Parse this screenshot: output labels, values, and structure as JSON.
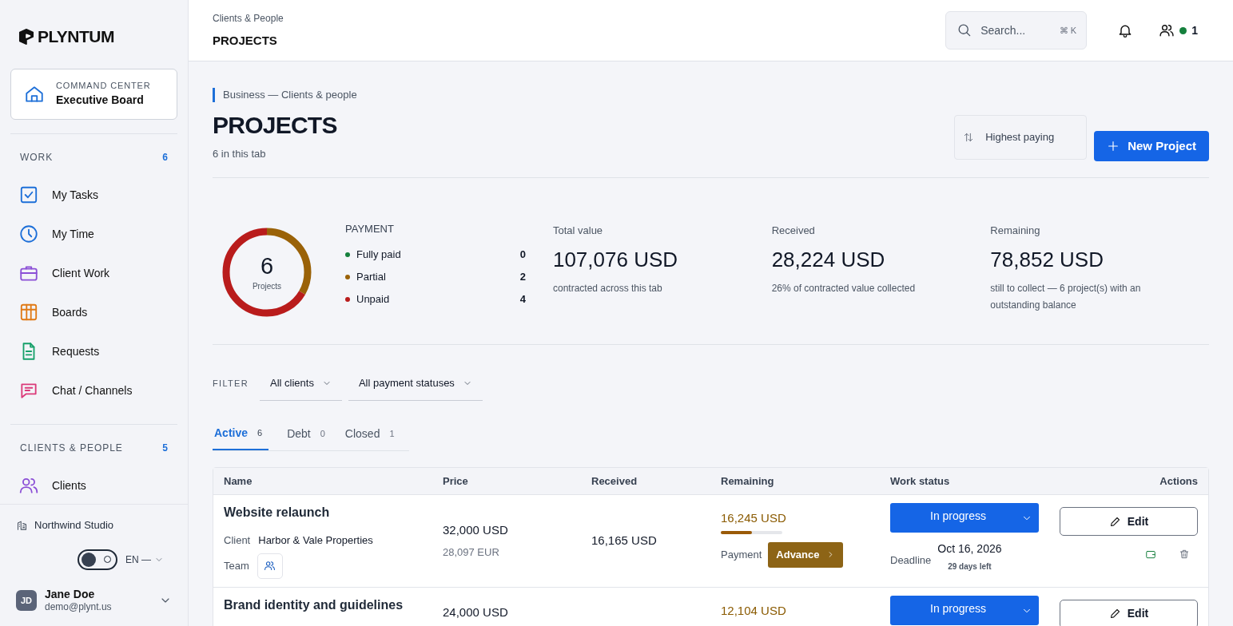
{
  "sidebar": {
    "logo": "PLYNTUM",
    "command_center": {
      "label": "COMMAND CENTER",
      "title": "Executive Board"
    },
    "sections": [
      {
        "title": "WORK",
        "count": "6",
        "items": [
          {
            "label": "My Tasks",
            "kind": "tasks",
            "color": "#1d6fd8"
          },
          {
            "label": "My Time",
            "kind": "time",
            "color": "#1d6fd8"
          },
          {
            "label": "Client Work",
            "kind": "briefcase",
            "color": "#8b4fd6"
          },
          {
            "label": "Boards",
            "kind": "boards",
            "color": "#e07a16"
          },
          {
            "label": "Requests",
            "kind": "document",
            "color": "#16a06a"
          },
          {
            "label": "Chat / Channels",
            "kind": "chat",
            "color": "#db3a7a"
          }
        ]
      },
      {
        "title": "CLIENTS & PEOPLE",
        "count": "5",
        "items": [
          {
            "label": "Clients",
            "kind": "people",
            "color": "#8b4fd6"
          }
        ]
      }
    ],
    "workspace": "Northwind Studio",
    "theme_toggle": {
      "on": false
    },
    "language": "EN —",
    "user": {
      "initials": "JD",
      "name": "Jane Doe",
      "email": "demo@plynt.us"
    }
  },
  "topbar": {
    "breadcrumb": "Clients & People",
    "title": "PROJECTS",
    "search": {
      "placeholder": "Search...",
      "shortcut": "⌘ K"
    },
    "online_count": "1"
  },
  "header": {
    "eyebrow": "Business — Clients & people",
    "title": "PROJECTS",
    "subtitle": "6 in this tab",
    "sort": "Highest paying",
    "new_button": "New Project"
  },
  "summary": {
    "donut": {
      "count": "6",
      "label": "Projects"
    },
    "payment": {
      "title": "PAYMENT",
      "items": [
        {
          "label": "Fully paid",
          "count": "0",
          "color": "#15803d"
        },
        {
          "label": "Partial",
          "count": "2",
          "color": "#9a6208"
        },
        {
          "label": "Unpaid",
          "count": "4",
          "color": "#b91c1c"
        }
      ]
    },
    "stats": [
      {
        "label": "Total value",
        "value": "107,076 USD",
        "note": "contracted across this tab"
      },
      {
        "label": "Received",
        "value": "28,224 USD",
        "note": "26% of contracted value collected"
      },
      {
        "label": "Remaining",
        "value": "78,852 USD",
        "note": "still to collect — 6 project(s) with an outstanding balance"
      }
    ]
  },
  "filter": {
    "label": "FILTER",
    "selects": [
      "All clients",
      "All payment statuses"
    ]
  },
  "tabs": [
    {
      "label": "Active",
      "count": "6",
      "selected": true
    },
    {
      "label": "Debt",
      "count": "0",
      "selected": false
    },
    {
      "label": "Closed",
      "count": "1",
      "selected": false
    }
  ],
  "table": {
    "columns": [
      "Name",
      "Price",
      "Received",
      "Remaining",
      "Work status",
      "Actions"
    ],
    "rows": [
      {
        "name": "Website relaunch",
        "client_label": "Client",
        "client": "Harbor & Vale Properties",
        "team_label": "Team",
        "price": "32,000 USD",
        "price_alt": "28,097 EUR",
        "received": "16,165 USD",
        "remaining": "16,245 USD",
        "level": 0.5,
        "payment_label": "Payment",
        "payment": "Advance",
        "status": "In progress",
        "deadline_label": "Deadline",
        "deadline": "Oct 16, 2026",
        "days_left": "29 days left",
        "edit": "Edit"
      },
      {
        "name": "Brand identity and guidelines",
        "price": "24,000 USD",
        "remaining": "12,104 USD",
        "status": "In progress",
        "edit": "Edit"
      }
    ]
  }
}
